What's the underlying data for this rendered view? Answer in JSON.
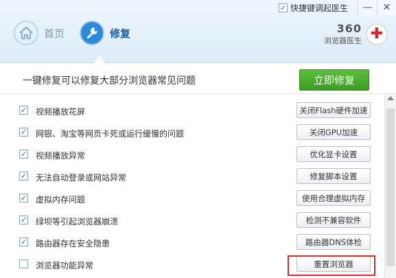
{
  "topbar": {
    "shortcut_label": "快捷键调起医生",
    "shortcut_checked": true,
    "minimize_glyph": "—",
    "close_glyph": "✕"
  },
  "nav": {
    "home_label": "首页",
    "repair_label": "修复"
  },
  "logo": {
    "brand": "360",
    "product": "浏览器医生"
  },
  "banner": {
    "text": "一键修复可以修复大部分浏览器常见问题",
    "fix_button": "立即修复"
  },
  "items": [
    {
      "label": "视频播放花屏",
      "action": "关闭Flash硬件加速",
      "checked": true
    },
    {
      "label": "网银、淘宝等网页卡死或运行缓慢的问题",
      "action": "关闭GPU加速",
      "checked": true
    },
    {
      "label": "视频播放异常",
      "action": "优化显卡设置",
      "checked": true
    },
    {
      "label": "无法自动登录或网站异常",
      "action": "修复脚本设置",
      "checked": true
    },
    {
      "label": "虚拟内存问题",
      "action": "使用合理虚拟内存",
      "checked": true
    },
    {
      "label": "绿坝等引起浏览器崩溃",
      "action": "检测不兼容软件",
      "checked": true
    },
    {
      "label": "路由器存在安全隐患",
      "action": "路由器DNS体检",
      "checked": true
    },
    {
      "label": "浏览器功能异常",
      "action": "重置浏览器",
      "checked": false
    }
  ],
  "colors": {
    "accent_blue": "#2d8ad9",
    "fix_green": "#3a9c21",
    "highlight_red": "#e0262a"
  }
}
